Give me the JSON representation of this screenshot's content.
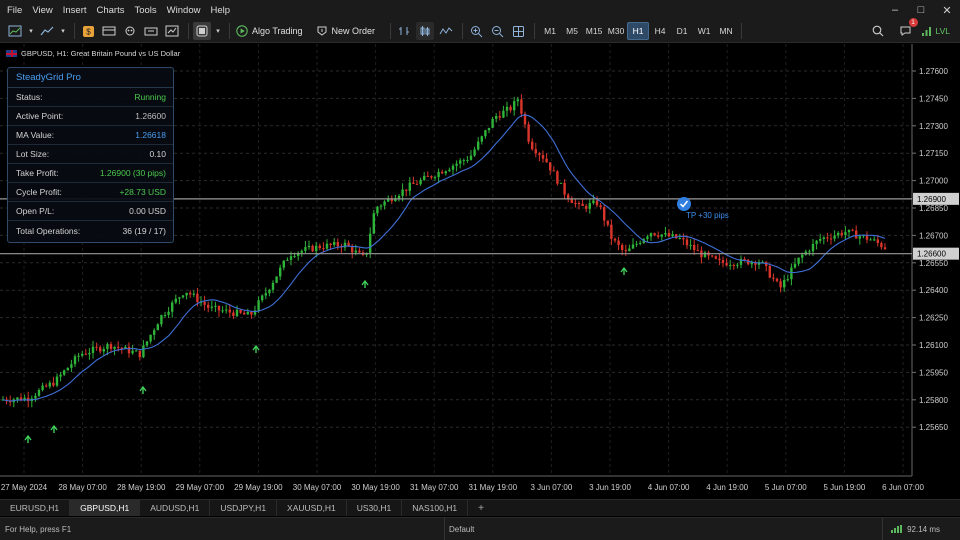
{
  "menu": [
    "File",
    "View",
    "Insert",
    "Charts",
    "Tools",
    "Window",
    "Help"
  ],
  "window_controls": [
    "–",
    "□",
    "✕"
  ],
  "toolbar": {
    "algo_trading": "Algo Trading",
    "new_order": "New Order",
    "timeframes": [
      "M1",
      "M5",
      "M15",
      "M30",
      "H1",
      "H4",
      "D1",
      "W1",
      "MN"
    ],
    "active_timeframe": "H1",
    "notification_count": "1",
    "account_label": "LVL"
  },
  "chart": {
    "title": "GBPUSD, H1:  Great Britain Pound vs US Dollar",
    "price_labels": [
      "1.27600",
      "1.27450",
      "1.27300",
      "1.27150",
      "1.27000",
      "1.26850",
      "1.26700",
      "1.26550",
      "1.26400",
      "1.26250",
      "1.26100",
      "1.25950",
      "1.25800",
      "1.25650"
    ],
    "time_labels": [
      "27 May 2024",
      "28 May 07:00",
      "28 May 19:00",
      "29 May 07:00",
      "29 May 19:00",
      "30 May 07:00",
      "30 May 19:00",
      "31 May 07:00",
      "31 May 19:00",
      "3 Jun 07:00",
      "3 Jun 19:00",
      "4 Jun 07:00",
      "4 Jun 19:00",
      "5 Jun 07:00",
      "5 Jun 19:00",
      "6 Jun 07:00"
    ],
    "tp_line_label": "1.26900",
    "active_line_label": "1.26600",
    "tp_annotation": "TP +30 pips",
    "colors": {
      "bull": "#2fb43a",
      "bear": "#d9352b",
      "ma": "#3f6fd8",
      "buy_arrow": "#3fd05a",
      "tp_circle": "#2f7ee0"
    }
  },
  "panel": {
    "title": "SteadyGrid Pro",
    "rows": [
      {
        "label": "Status:",
        "value": "Running",
        "color": "#4cc94c"
      },
      {
        "label": "Active Point:",
        "value": "1.26600",
        "color": "#bdbdbd"
      },
      {
        "label": "MA Value:",
        "value": "1.26618",
        "color": "#4a9df0"
      },
      {
        "label": "Lot Size:",
        "value": "0.10",
        "color": "#d4d4d4"
      },
      {
        "label": "Take Profit:",
        "value": "1.26900 (30 pips)",
        "color": "#4cc94c"
      },
      {
        "label": "Cycle Profit:",
        "value": "+28.73 USD",
        "color": "#4cc94c"
      },
      {
        "label": "Open P/L:",
        "value": "0.00 USD",
        "color": "#d4d4d4"
      },
      {
        "label": "Total Operations:",
        "value": "36 (19 / 17)",
        "color": "#d4d4d4"
      }
    ]
  },
  "tabs": [
    "EURUSD,H1",
    "GBPUSD,H1",
    "AUDUSD,H1",
    "USDJPY,H1",
    "XAUUSD,H1",
    "US30,H1",
    "NAS100,H1"
  ],
  "active_tab": "GBPUSD,H1",
  "status": {
    "help": "For Help, press F1",
    "profile": "Default",
    "connection": "92.14 ms"
  }
}
